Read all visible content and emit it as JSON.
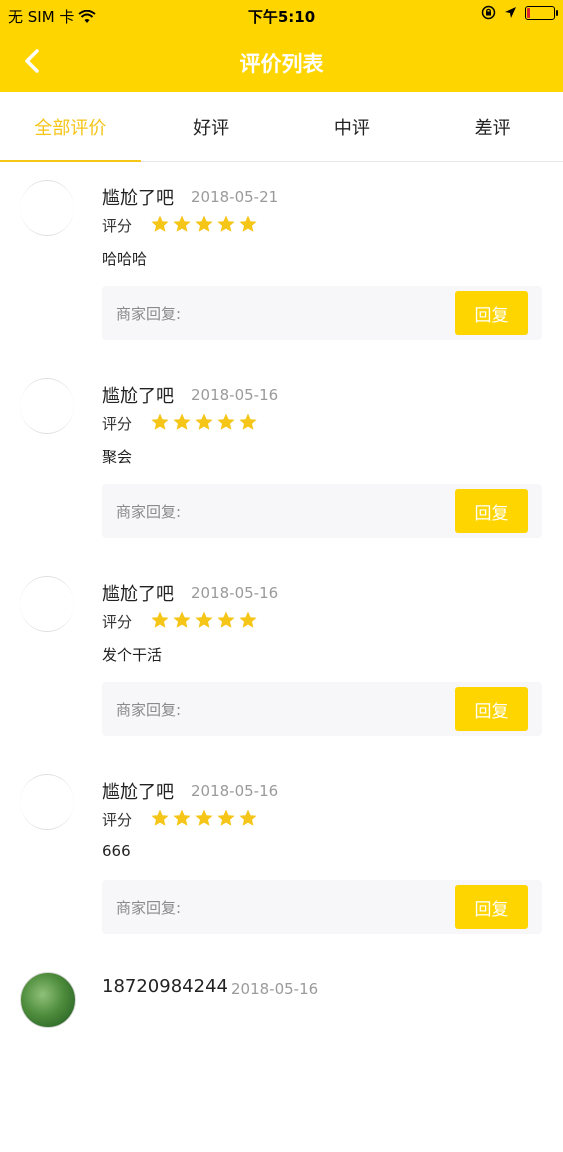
{
  "status_bar": {
    "carrier": "无 SIM 卡",
    "time": "下午5:10"
  },
  "nav": {
    "title": "评价列表"
  },
  "tabs": [
    {
      "label": "全部评价",
      "active": true
    },
    {
      "label": "好评",
      "active": false
    },
    {
      "label": "中评",
      "active": false
    },
    {
      "label": "差评",
      "active": false
    }
  ],
  "score_label": "评分",
  "reply_label": "商家回复:",
  "reply_button": "回复",
  "reviews": [
    {
      "name": "尴尬了吧",
      "date": "2018-05-21",
      "rating": 5,
      "content": "哈哈哈"
    },
    {
      "name": "尴尬了吧",
      "date": "2018-05-16",
      "rating": 5,
      "content": "聚会"
    },
    {
      "name": "尴尬了吧",
      "date": "2018-05-16",
      "rating": 5,
      "content": "发个干活"
    },
    {
      "name": "尴尬了吧",
      "date": "2018-05-16",
      "rating": 5,
      "content": "666"
    },
    {
      "name": "18720984244",
      "date": "2018-05-16"
    }
  ],
  "colors": {
    "brand_yellow": "#FFD500",
    "star_yellow": "#F5C518",
    "date_gray": "#9a9a9a"
  }
}
